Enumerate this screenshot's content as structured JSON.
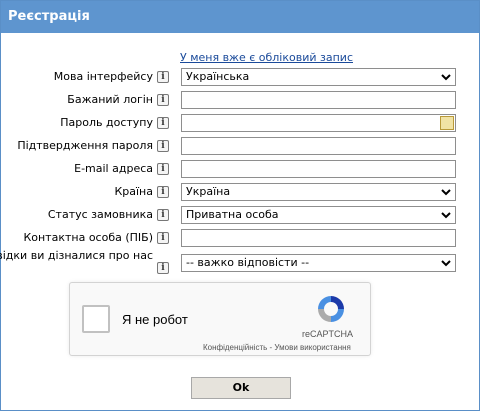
{
  "header": {
    "title": "Реєстрація"
  },
  "login_link": "У меня вже є обліковий запис",
  "fields": {
    "language": {
      "label": "Мова інтерфейсу",
      "value": "Українська"
    },
    "login": {
      "label": "Бажаний логін",
      "value": ""
    },
    "password": {
      "label": "Пароль доступу",
      "value": ""
    },
    "password_confirm": {
      "label": "Підтвердження пароля",
      "value": ""
    },
    "email": {
      "label": "E-mail адреса",
      "value": ""
    },
    "country": {
      "label": "Країна",
      "value": "Україна"
    },
    "status": {
      "label": "Статус замовника",
      "value": "Приватна особа"
    },
    "contact": {
      "label": "Контактна особа (ПІБ)",
      "value": ""
    },
    "source": {
      "label": "Звідки ви дізналися про нас",
      "value": "-- важко відповісти --"
    }
  },
  "info_glyph": "i",
  "captcha": {
    "label": "Я не робот",
    "brand": "reCAPTCHA",
    "privacy": "Конфіденційність",
    "separator": " - ",
    "terms": "Умови використання"
  },
  "ok_label": "Ok",
  "colors": {
    "header": "#5e95cf",
    "link": "#1a4a9a",
    "button": "#e6e3dc"
  }
}
